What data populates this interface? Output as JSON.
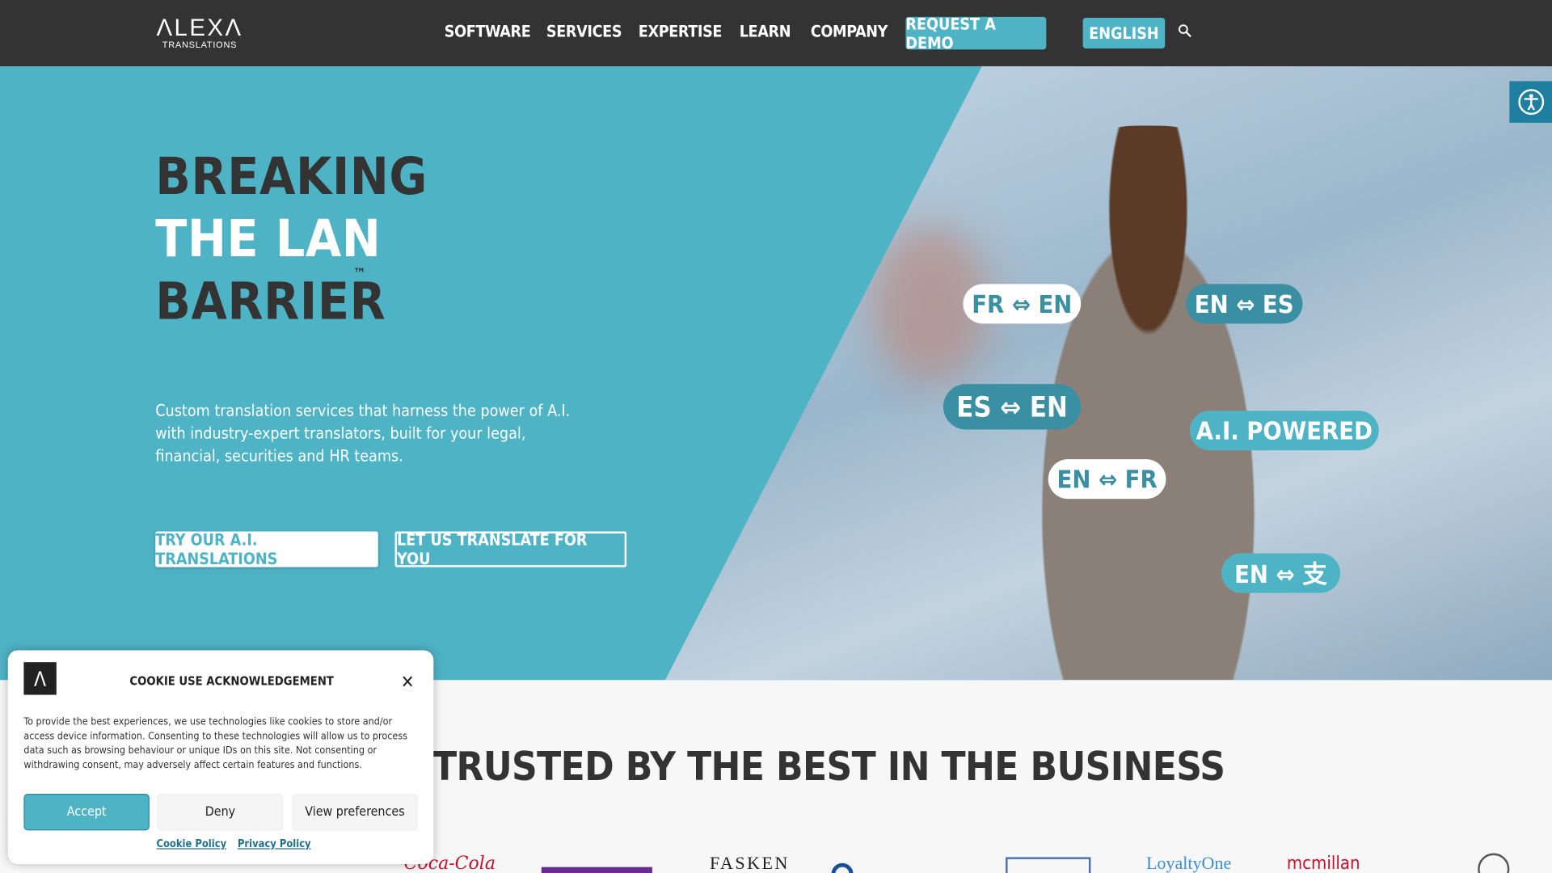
{
  "brand": {
    "logo_main": "ΛLEXΛ",
    "logo_sub": "TRANSLATIONS"
  },
  "nav": {
    "items": [
      "SOFTWARE",
      "SERVICES",
      "EXPERTISE",
      "LEARN",
      "COMPANY"
    ],
    "demo": "REQUEST A DEMO",
    "language": "ENGLISH",
    "search_icon": "search-icon"
  },
  "hero": {
    "line1": "BREAKING",
    "line2": "THE LANG",
    "line3": "BARRIER",
    "tm": "™",
    "subtitle": "Custom translation services that harness the power of A.I. with industry-expert translators, built for your legal, financial, securities and HR teams.",
    "cta_primary": "TRY OUR A.I. TRANSLATIONS",
    "cta_secondary": "LET US TRANSLATE FOR YOU",
    "pills": [
      "FR ⇔ EN",
      "EN ⇔ ES",
      "ES ⇔ EN",
      "A.I. POWERED",
      "EN ⇔ FR",
      "EN ⇔ 支"
    ]
  },
  "accessibility_icon": "accessibility-icon",
  "trusted": {
    "title": "TRUSTED BY THE BEST IN THE BUSINESS",
    "logos": [
      "Coca-Cola",
      "FASKEN",
      "LoyaltyOne",
      "mcmillan"
    ]
  },
  "cookie": {
    "title": "COOKIE USE ACKNOWLEDGEMENT",
    "logo": "Λ",
    "text": "To provide the best experiences, we use technologies like cookies to store and/or access device information. Consenting to these technologies will allow us to process data such as browsing behaviour or unique IDs on this site. Not consenting or withdrawing consent, may adversely affect certain features and functions.",
    "accept": "Accept",
    "deny": "Deny",
    "preferences": "View preferences",
    "cookie_policy": "Cookie Policy",
    "privacy_policy": "Privacy Policy"
  },
  "colors": {
    "accent": "#4fb3c6",
    "nav_bg": "#333333",
    "pill_dark": "#3a8fa3"
  }
}
